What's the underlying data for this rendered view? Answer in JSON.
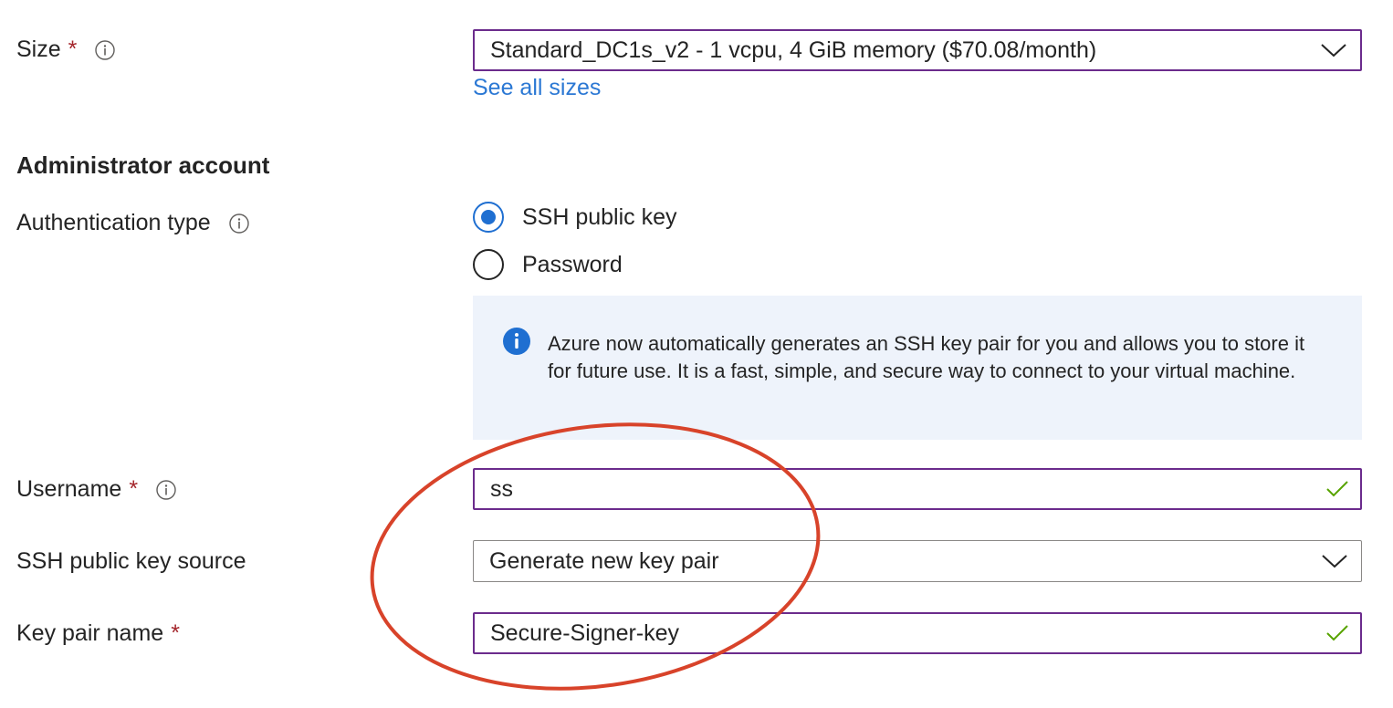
{
  "size": {
    "label": "Size",
    "required_mark": "*",
    "selected": "Standard_DC1s_v2 - 1 vcpu, 4 GiB memory ($70.08/month)",
    "see_all_link": "See all sizes"
  },
  "admin_section": {
    "heading": "Administrator account"
  },
  "auth_type": {
    "label": "Authentication type",
    "options": [
      {
        "label": "SSH public key",
        "selected": true
      },
      {
        "label": "Password",
        "selected": false
      }
    ]
  },
  "info_banner": {
    "message": "Azure now automatically generates an SSH key pair for you and allows you to store it for future use. It is a fast, simple, and secure way to connect to your virtual machine."
  },
  "username": {
    "label": "Username",
    "required_mark": "*",
    "value": "ss"
  },
  "ssh_key_source": {
    "label": "SSH public key source",
    "selected": "Generate new key pair"
  },
  "key_pair_name": {
    "label": "Key pair name",
    "required_mark": "*",
    "value": "Secure-Signer-key"
  },
  "colors": {
    "accent_purple": "#6b2b8c",
    "link_blue": "#2b78d4",
    "radio_blue": "#1f6fd1",
    "required_red": "#a4262c",
    "valid_green": "#57a300",
    "annotation_red": "#d8432a",
    "banner_bg": "#eef3fb"
  },
  "icons": [
    "info-icon",
    "chevron-down-icon",
    "checkmark-icon",
    "info-filled-icon"
  ]
}
